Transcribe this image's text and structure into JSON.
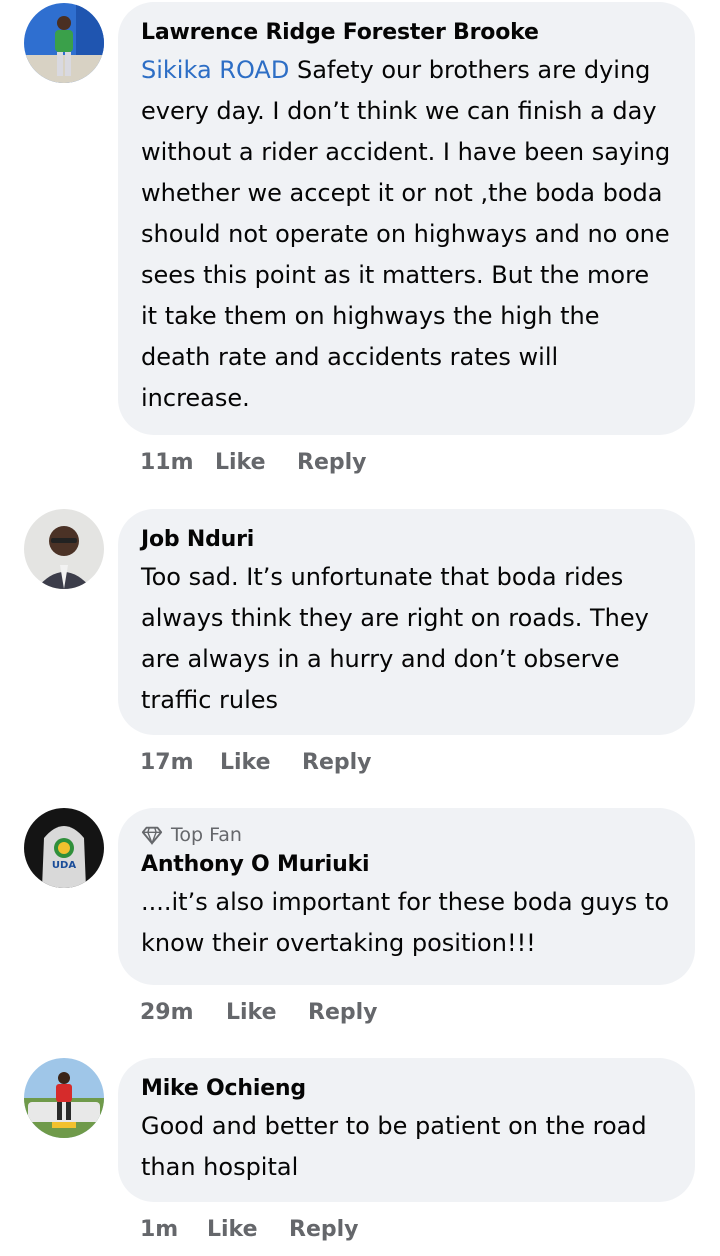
{
  "comments": [
    {
      "author": "Lawrence Ridge Forester Brooke",
      "mention": "Sikika ROAD",
      "text": " Safety our  brothers are dying every day. I don’t think we can finish a day without a rider accident. I have been saying whether we accept it or not ,the boda boda should not operate on highways and no one sees this point as it matters. But the more it take them on highways the high the death rate and accidents  rates will increase.",
      "time": "11m",
      "like_label": "Like",
      "reply_label": "Reply"
    },
    {
      "author": "Job Nduri",
      "text": "Too sad. It’s unfortunate that boda rides always think they are right on roads. They are always in a hurry and don’t observe traffic rules",
      "time": "17m",
      "like_label": "Like",
      "reply_label": "Reply"
    },
    {
      "badge": "Top Fan",
      "author": "Anthony O Muriuki",
      "text": "....it’s also important for these boda guys to know their overtaking position!!!",
      "time": "29m",
      "like_label": "Like",
      "reply_label": "Reply",
      "avatar_logo_text": "UDA"
    },
    {
      "author": "Mike Ochieng",
      "text": "Good and better to be patient on the road than hospital",
      "time": "1m",
      "like_label": "Like",
      "reply_label": "Reply"
    }
  ],
  "colors": {
    "bubble": "#f0f2f5",
    "mention": "#2d6ec5",
    "meta": "#65676b",
    "text": "#050505"
  }
}
